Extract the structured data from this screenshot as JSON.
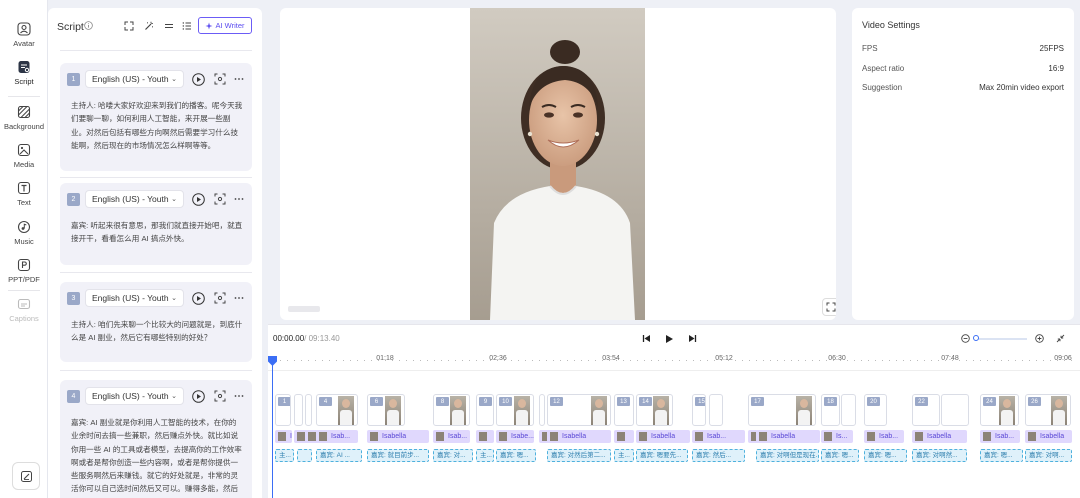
{
  "sidebar": {
    "items": [
      {
        "label": "Avatar"
      },
      {
        "label": "Script"
      },
      {
        "label": "Background"
      },
      {
        "label": "Media"
      },
      {
        "label": "Text"
      },
      {
        "label": "Music"
      },
      {
        "label": "PPT/PDF"
      },
      {
        "label": "Captions"
      }
    ]
  },
  "script": {
    "title": "Script",
    "ai_writer": "AI Writer",
    "blocks": [
      {
        "num": "1",
        "voice": "English (US) - Youth",
        "text": "主持人: 哈喽大家好欢迎来到我们的播客。呢今天我们要聊一聊，如何利用人工智能，来开展一些副业。对然后包括有哪些方向啊然后需要学习什么技能啊，然后现在的市场情况怎么样啊等等。"
      },
      {
        "num": "2",
        "voice": "English (US) - Youth",
        "text": "嘉宾: 听起来很有意思，那我们就直接开始吧，就直接开干，看看怎么用 AI 搞点外快。"
      },
      {
        "num": "3",
        "voice": "English (US) - Youth",
        "text": "主持人: 咱们先来聊一个比较大的问题就是，到底什么是 AI 副业，然后它有哪些特别的好处？"
      },
      {
        "num": "4",
        "voice": "English (US) - Youth",
        "text": "嘉宾: AI 副业就是你利用人工智能的技术，在你的业余时间去搞一些兼职，然后赚点外快。就比如说你用一些 AI 的工具或者模型，去提高你的工作效率啊或者是帮你创造一些内容啊，或者是帮你提供一些服务啊然后来赚钱。就它的好处就是，非常的灵活你可以自己选时间然后又可以。赚得多能，然后又能用在 AI 这个市场容易的"
      }
    ]
  },
  "settings": {
    "title": "Video Settings",
    "rows": [
      {
        "label": "FPS",
        "value": "25FPS"
      },
      {
        "label": "Aspect ratio",
        "value": "16:9"
      },
      {
        "label": "Suggestion",
        "value": "Max 20min video export"
      }
    ]
  },
  "timeline": {
    "current": "00:00.00",
    "total": "/ 09:13.40",
    "ticks": [
      "01:18",
      "02:36",
      "03:54",
      "05:12",
      "06:30",
      "07:48",
      "09:06"
    ],
    "clips": [
      "1",
      "",
      "",
      "4",
      "6",
      "8",
      "9",
      "10",
      "",
      "12",
      "13",
      "14",
      "15",
      "",
      "17",
      "18",
      "",
      "20",
      "22",
      "",
      "24",
      "26"
    ],
    "avatar_tracks": [
      {
        "label": "I"
      },
      {
        "label": ""
      },
      {
        "label": ""
      },
      {
        "label": "Isab..."
      },
      {
        "label": "Isabella"
      },
      {
        "label": "Isab..."
      },
      {
        "label": ""
      },
      {
        "label": "Isabe..."
      },
      {
        "label": ""
      },
      {
        "label": "Isabella"
      },
      {
        "label": ""
      },
      {
        "label": "Isabella"
      },
      {
        "label": "Isab..."
      },
      {
        "label": ""
      },
      {
        "label": "Isabella"
      },
      {
        "label": "Is..."
      },
      {
        "label": "Isab..."
      },
      {
        "label": "Isabella"
      },
      {
        "label": "Isab..."
      },
      {
        "label": "Isabella"
      }
    ],
    "caption_tracks": [
      {
        "label": "主..."
      },
      {
        "label": ""
      },
      {
        "label": "嘉宾: AI ..."
      },
      {
        "label": "嘉宾: 就目前步..."
      },
      {
        "label": "嘉宾: 对..."
      },
      {
        "label": "主..."
      },
      {
        "label": "嘉宾: 嗯..."
      },
      {
        "label": "嘉宾: 对然后第二..."
      },
      {
        "label": "主..."
      },
      {
        "label": "嘉宾: 嗯要先..."
      },
      {
        "label": "嘉宾: 然后..."
      },
      {
        "label": "嘉宾: 对啊但是现在..."
      },
      {
        "label": "嘉宾: 嗯..."
      },
      {
        "label": "嘉宾: 嗯..."
      },
      {
        "label": "嘉宾: 对啊然..."
      },
      {
        "label": "嘉宾: 嗯..."
      },
      {
        "label": "嘉宾: 对啊..."
      }
    ]
  }
}
